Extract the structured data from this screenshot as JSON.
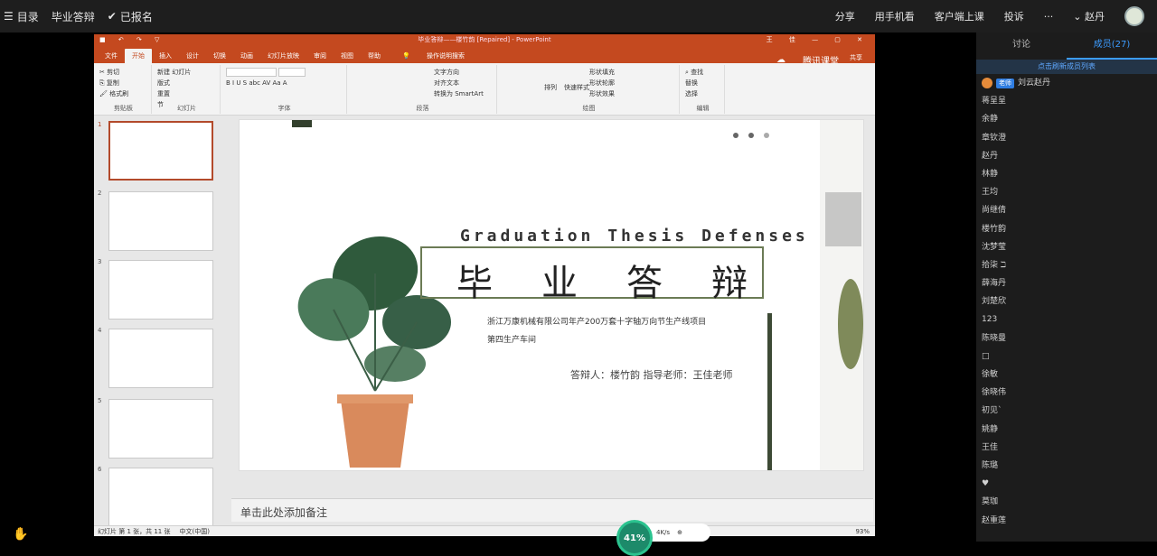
{
  "topbar": {
    "menu_label": "目录",
    "meeting_title": "毕业答辩",
    "registered_label": "已报名",
    "share": "分享",
    "phone_view": "用手机看",
    "client_class": "客户端上课",
    "complain": "投诉",
    "more": "···",
    "user_name": "赵丹"
  },
  "ppt": {
    "window_title": "毕业答辩——楼竹韵 [Repaired] - PowerPoint",
    "quick_access": "■ ↶ ↷ ▽",
    "user_short": "王 佳",
    "window_controls": "— ▢ ✕",
    "tabs": [
      "文件",
      "开始",
      "插入",
      "设计",
      "切换",
      "动画",
      "幻灯片放映",
      "审阅",
      "视图",
      "帮助",
      "操作说明搜索"
    ],
    "active_tab": "开始",
    "brand": "腾讯课堂",
    "share": "共享",
    "ribbon": {
      "clipboard": {
        "paste": "粘贴",
        "cut": "剪切",
        "copy": "复制",
        "format": "格式刷",
        "label": "剪贴板"
      },
      "slides": {
        "new": "新建",
        "new2": "幻灯片",
        "layout": "版式",
        "reset": "重置",
        "section": "节",
        "label": "幻灯片"
      },
      "font": {
        "label": "字体",
        "buttons": "B I U S abc AV Aa A"
      },
      "paragraph": {
        "text_dir": "文字方向",
        "align_text": "对齐文本",
        "smartart": "转换为 SmartArt",
        "label": "段落"
      },
      "drawing": {
        "arrange": "排列",
        "quick_styles": "快速样式",
        "fill": "形状填充",
        "outline": "形状轮廓",
        "effects": "形状效果",
        "label": "绘图"
      },
      "editing": {
        "find": "查找",
        "replace": "替换",
        "select": "选择",
        "label": "编辑"
      }
    },
    "thumb_numbers": [
      "1",
      "2",
      "3",
      "4",
      "5",
      "6"
    ],
    "star": "★",
    "slide": {
      "en_title": "Graduation Thesis Defenses",
      "cn_title": "毕业答辩",
      "subtitle": "浙江万康机械有限公司年产200万套十字轴万向节生产线项目第四生产车间",
      "byline": "答辩人：楼竹韵     指导老师：王佳老师"
    },
    "notes_placeholder": "单击此处添加备注",
    "status": {
      "slide_info": "幻灯片 第 1 张，共 11 张",
      "lang": "中文(中国)",
      "zoom": "93%"
    }
  },
  "overlay": {
    "gauge": "41%",
    "speed": "4K/s"
  },
  "panel": {
    "tab_discuss": "讨论",
    "tab_members": "成员(27)",
    "notice": "点击刷新成员列表",
    "host_tag": "老师",
    "members": [
      "刘云赵丹",
      "蒋呈呈",
      "余静",
      "章钦澄",
      "赵丹",
      "林静",
      "王均",
      "尚继倩",
      "楼竹韵",
      "沈梦莹",
      "拾柒 ℶ",
      "薛海丹",
      "刘楚欣",
      "123",
      "陈晓曼",
      "□",
      "徐敏",
      "徐晓伟",
      "初见`",
      "姚静",
      "王佳",
      "陈璐",
      "♥",
      "莫珈",
      "赵重莲"
    ]
  },
  "colors": {
    "ppt_accent": "#c4491f",
    "panel_accent": "#3c9cff",
    "slide_green": "#6b7b55"
  }
}
